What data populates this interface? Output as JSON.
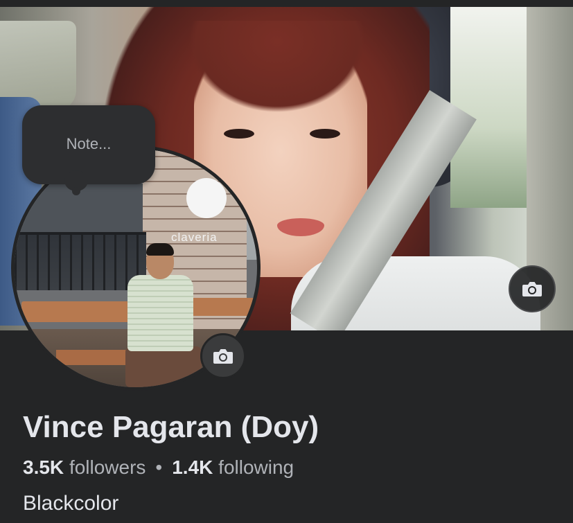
{
  "cover": {
    "camera_icon": "camera-icon"
  },
  "profile_picture": {
    "sign_text": "claveria",
    "camera_icon": "camera-icon"
  },
  "note": {
    "placeholder": "Note..."
  },
  "profile": {
    "name": "Vince Pagaran (Doy)",
    "followers_count": "3.5K",
    "followers_label": "followers",
    "separator": "•",
    "following_count": "1.4K",
    "following_label": "following",
    "bio": "Blackcolor"
  },
  "colors": {
    "background": "#242526",
    "primary_text": "#e4e6eb",
    "secondary_text": "#b0b3b8",
    "button_bg": "#3a3b3c"
  }
}
